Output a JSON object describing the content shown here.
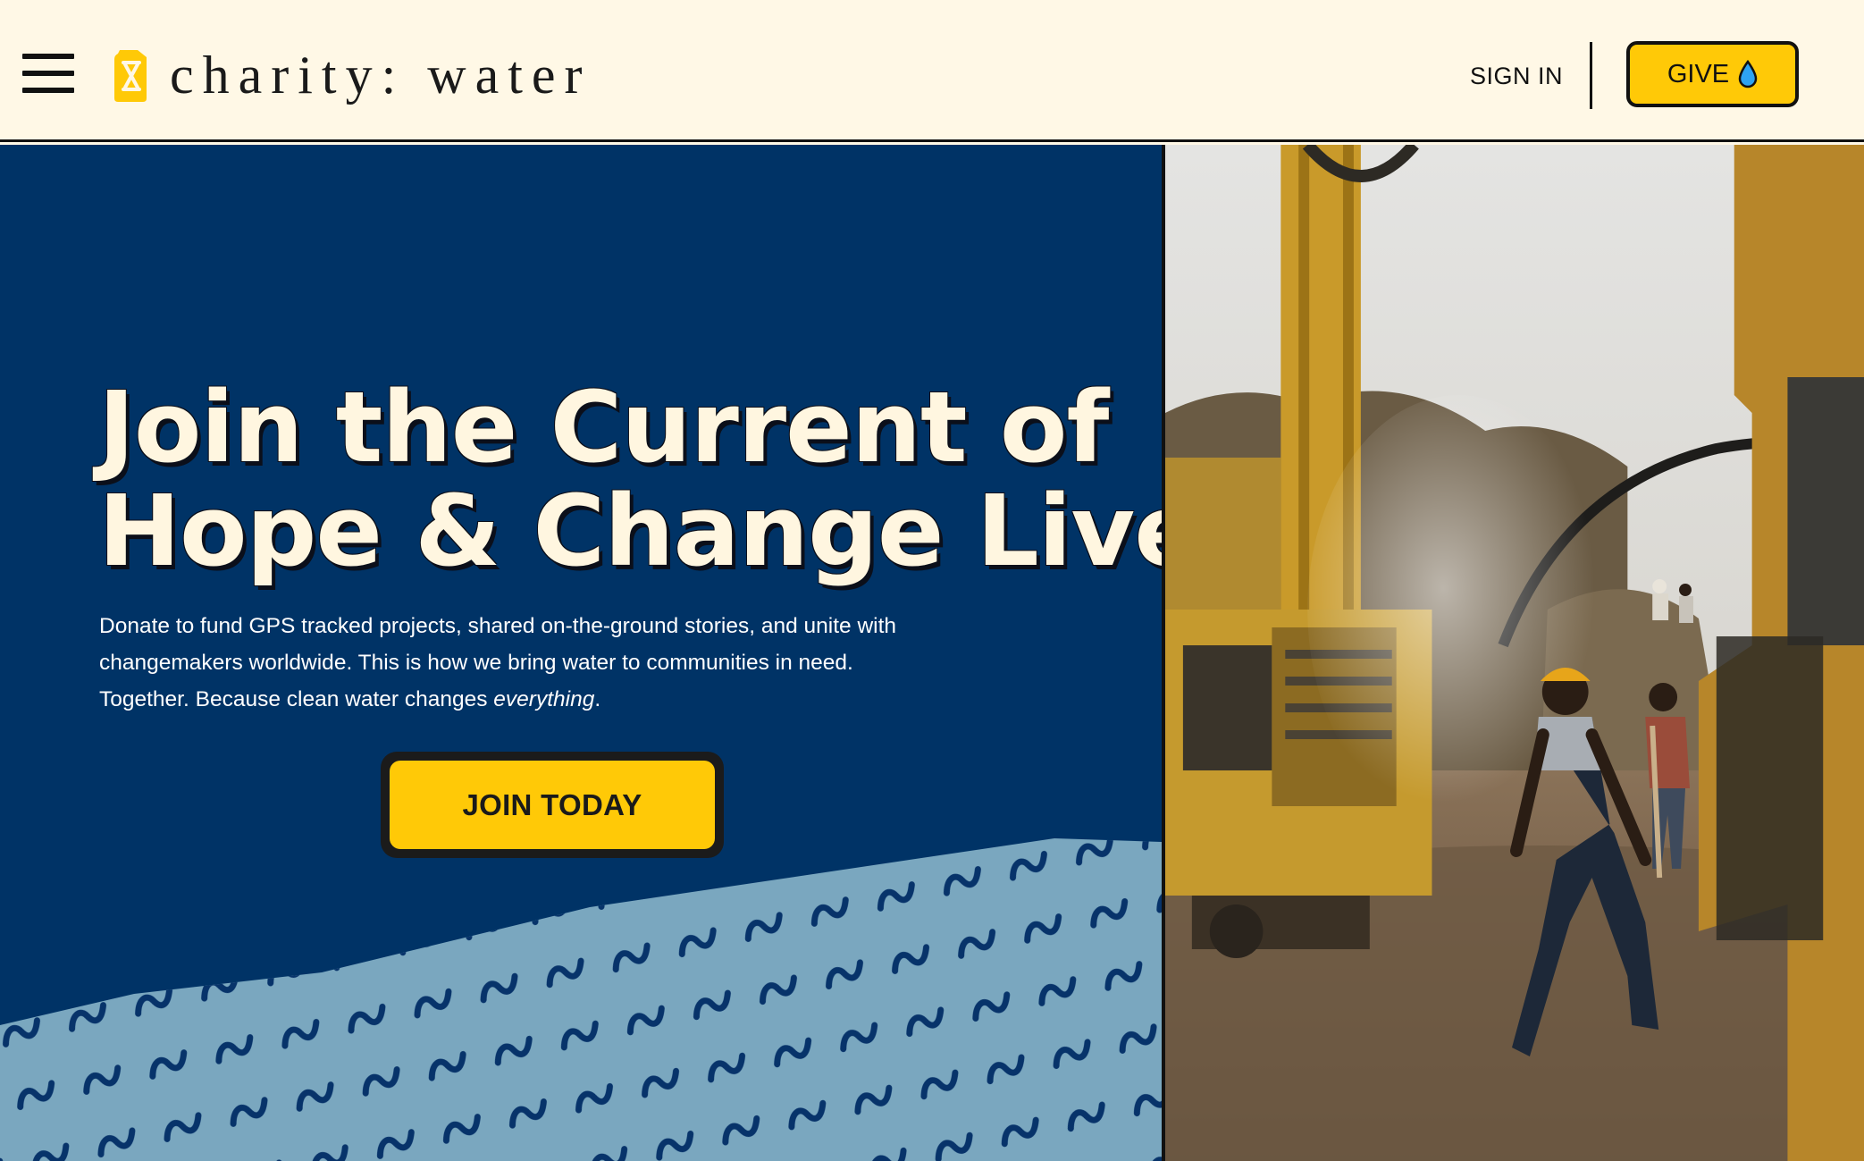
{
  "header": {
    "menu_icon": "hamburger-menu-icon",
    "logo_icon": "jerry-can-icon",
    "logo_text": "charity: water",
    "sign_in_label": "SIGN IN",
    "give_label": "GIVE",
    "give_icon": "water-drop-icon"
  },
  "hero": {
    "headline_line1": "Join the Current of",
    "headline_line2": "Hope & Change Lives",
    "subtext_main": "Donate to fund GPS tracked projects, shared on-the-ground stories, and unite with changemakers worldwide. This is how we bring water to communities in need. Together. Because clean water changes ",
    "subtext_emphasis": "everything",
    "subtext_end": ".",
    "cta_label": "JOIN TODAY"
  },
  "colors": {
    "background": "#fff8e6",
    "navy": "#003366",
    "yellow": "#ffc907",
    "wave_light": "#7aa7bf",
    "text_dark": "#111111"
  },
  "photo": {
    "subject": "drilling-rig-workers-photo"
  }
}
